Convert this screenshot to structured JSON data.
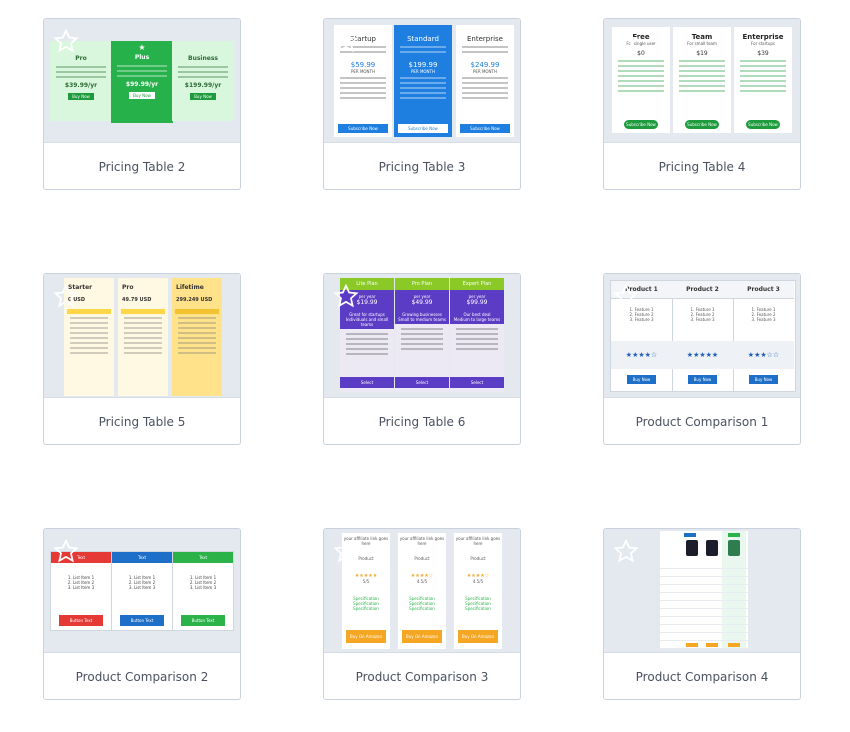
{
  "cards": [
    {
      "label": "Pricing Table 2"
    },
    {
      "label": "Pricing Table 3"
    },
    {
      "label": "Pricing Table 4"
    },
    {
      "label": "Pricing Table 5"
    },
    {
      "label": "Pricing Table 6"
    },
    {
      "label": "Product Comparison 1"
    },
    {
      "label": "Product Comparison 2"
    },
    {
      "label": "Product Comparison 3"
    },
    {
      "label": "Product Comparison 4"
    }
  ],
  "pt2": {
    "cols": [
      {
        "title": "Pro",
        "price": "$39.99/yr",
        "btn": "Buy Now"
      },
      {
        "title": "Plus",
        "price": "$99.99/yr",
        "btn": "Buy Now"
      },
      {
        "title": "Business",
        "price": "$199.99/yr",
        "btn": "Buy Now"
      }
    ],
    "list": [
      "1 List Item 1",
      "1 List Item 2",
      "1 List Item 3"
    ]
  },
  "pt3": {
    "cols": [
      {
        "title": "Startup",
        "price": "$59.99",
        "per": "PER MONTH",
        "btn": "Subscribe Now"
      },
      {
        "title": "Standard",
        "price": "$199.99",
        "per": "PER MONTH",
        "btn": "Subscribe Now"
      },
      {
        "title": "Enterprise",
        "price": "$249.99",
        "per": "PER MONTH",
        "btn": "Subscribe Now"
      }
    ]
  },
  "pt4": {
    "cols": [
      {
        "title": "Free",
        "sub": "For single user",
        "price": "$0",
        "btn": "Subscribe Now"
      },
      {
        "title": "Team",
        "sub": "For small team",
        "price": "$19",
        "btn": "Subscribe Now"
      },
      {
        "title": "Enterprise",
        "sub": "For startups",
        "price": "$39",
        "btn": "Subscribe Now"
      }
    ],
    "features": [
      "25 Emails Per Month",
      "Guide & Tutorials",
      "24/7 Support",
      "Limited Library",
      "Limited Lists",
      "New List Item",
      "New List Item"
    ]
  },
  "pt5": {
    "cols": [
      {
        "title": "Starter",
        "price": "0 USD"
      },
      {
        "title": "Pro",
        "price": "49.79 USD"
      },
      {
        "title": "Lifetime",
        "price": "299.249 USD"
      }
    ]
  },
  "pt6": {
    "cols": [
      {
        "title": "Lite Plan",
        "per": "per year",
        "price": "$19.99",
        "tag1": "Great for startups",
        "tag2": "Individuals and small teams",
        "btn": "Select"
      },
      {
        "title": "Pro Plan",
        "per": "per year",
        "price": "$49.99",
        "tag1": "Growing businesses",
        "tag2": "Small to medium teams",
        "btn": "Select"
      },
      {
        "title": "Expert Plan",
        "per": "per year",
        "price": "$99.99",
        "tag1": "Our best deal",
        "tag2": "Medium to large teams",
        "btn": "Select"
      }
    ],
    "features": [
      "Clean and easy setup",
      "Simple newsletter generator",
      "Integrated dashboard",
      "Live support",
      "Extra Add-ons"
    ]
  },
  "pc1": {
    "cols": [
      {
        "title": "Product 1",
        "stars": "★★★★☆",
        "btn": "Buy Now"
      },
      {
        "title": "Product 2",
        "stars": "★★★★★",
        "btn": "Buy Now"
      },
      {
        "title": "Product 3",
        "stars": "★★★☆☆",
        "btn": "Buy Now"
      }
    ],
    "features": [
      "1. Feature 1",
      "2. Feature 2",
      "3. Feature 3"
    ]
  },
  "pc2": {
    "cols": [
      {
        "title": "Text",
        "btn": "Button Text",
        "color": "#e53935"
      },
      {
        "title": "Text",
        "btn": "Button Text",
        "color": "#1e6fc8"
      },
      {
        "title": "Text",
        "btn": "Button Text",
        "color": "#2bb34a"
      }
    ],
    "items": [
      "1. List Item 1",
      "2. List Item 2",
      "3. List Item 3"
    ]
  },
  "pc3": {
    "cols": [
      {
        "tagline": "your affiliate link goes here",
        "name": "Product",
        "stars": "★★★★★",
        "score": "5/5",
        "btn": "Buy On Amazon"
      },
      {
        "tagline": "your affiliate link goes here",
        "name": "Product",
        "stars": "★★★★☆",
        "score": "4.5/5",
        "btn": "Buy On Amazon"
      },
      {
        "tagline": "your affiliate link goes here",
        "name": "Product",
        "stars": "★★★★☆",
        "score": "4.5/5",
        "btn": "Buy On Amazon"
      }
    ],
    "specs": [
      "Specification",
      "Specification",
      "Specification"
    ]
  },
  "colors": {
    "border": "#c9d1dc",
    "thumb_bg": "#e4e9f0",
    "label": "#4a5260",
    "star": "#ffffff"
  }
}
